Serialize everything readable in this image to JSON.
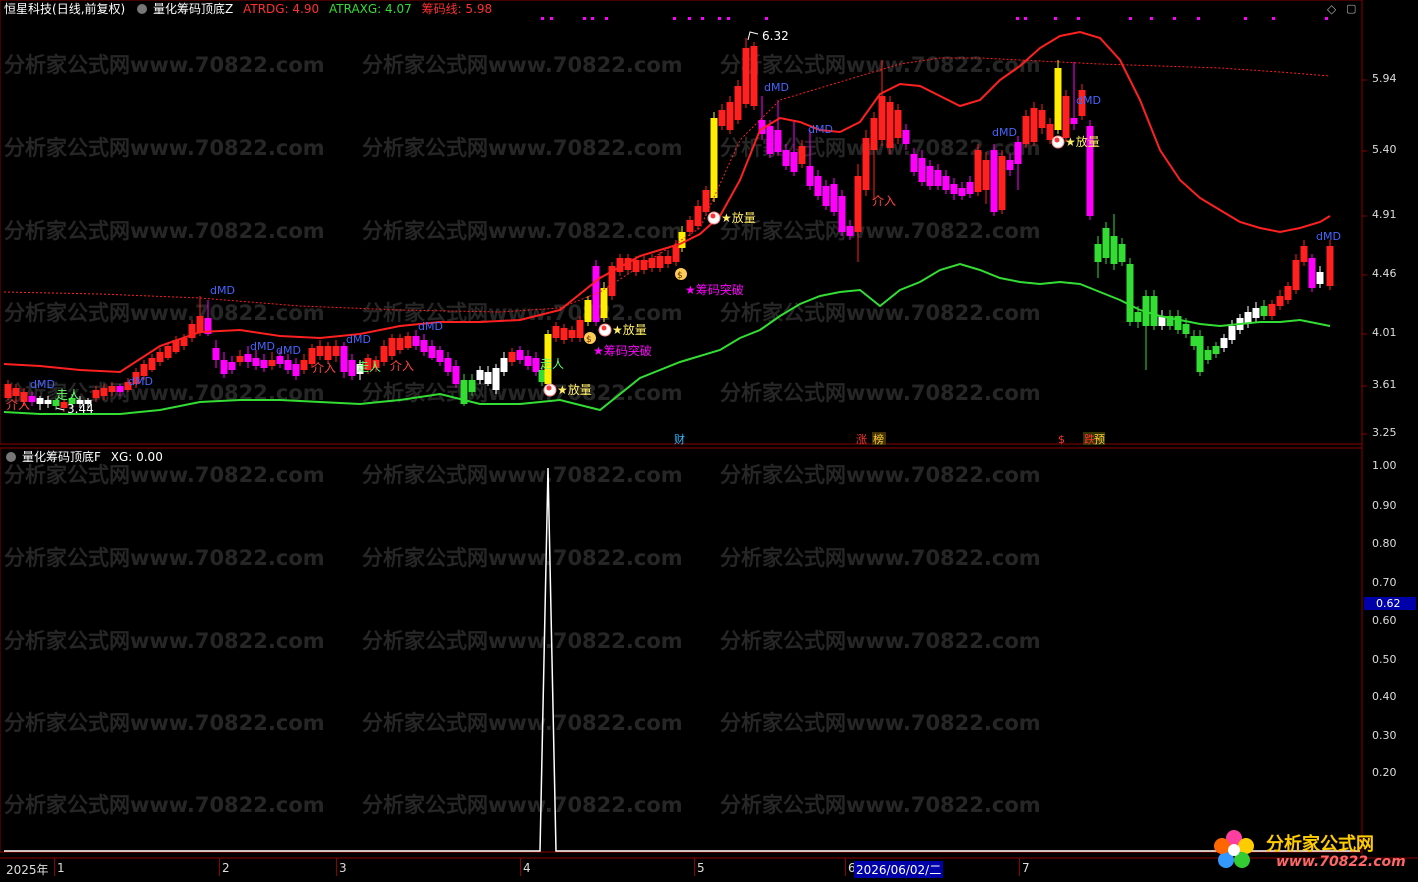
{
  "header": {
    "stock_name": "恒星科技",
    "period": "(日线,前复权)",
    "indicator_name": "量化筹码顶底Z",
    "atrdg": "ATRDG: 4.90",
    "atraxg": "ATRAXG: 4.07",
    "chip_line": "筹码线: 5.98"
  },
  "lower_header": {
    "indicator_name": "量化筹码顶底F",
    "xg": "XG: 0.00"
  },
  "colors": {
    "red": "#ff2020",
    "green": "#33dd33",
    "magenta": "#ff00ff",
    "yellow": "#ffee00",
    "white": "#ffffff",
    "grid": "#8b0000"
  },
  "price_axis": [
    "5.94",
    "5.40",
    "4.91",
    "4.46",
    "4.01",
    "3.61",
    "3.25"
  ],
  "lower_axis": [
    "1.00",
    "0.90",
    "0.80",
    "0.70",
    "0.62",
    "0.60",
    "0.50",
    "0.40",
    "0.30",
    "0.20"
  ],
  "time_axis": {
    "year": "2025年",
    "months": [
      "1",
      "2",
      "3",
      "4",
      "5",
      "6",
      "7"
    ],
    "cursor_date": "2026/06/02/二"
  },
  "annotations": {
    "high": "6.32",
    "low": "3.44",
    "fang_liang": "★放量",
    "chip_break": "★筹码突破",
    "jie_ru": "介入",
    "zou_ren": "走人",
    "dmd": "dMD"
  },
  "event_tags": {
    "cai": "财",
    "zhang": "涨",
    "bang": "榜",
    "dollar": "$",
    "yu": "预",
    "xie": "跌"
  },
  "watermark": "分析家公式网www.70822.com",
  "logo": {
    "text": "分析家公式网",
    "url": "www.70822.com"
  },
  "lower_cursor_value": "0.62"
}
